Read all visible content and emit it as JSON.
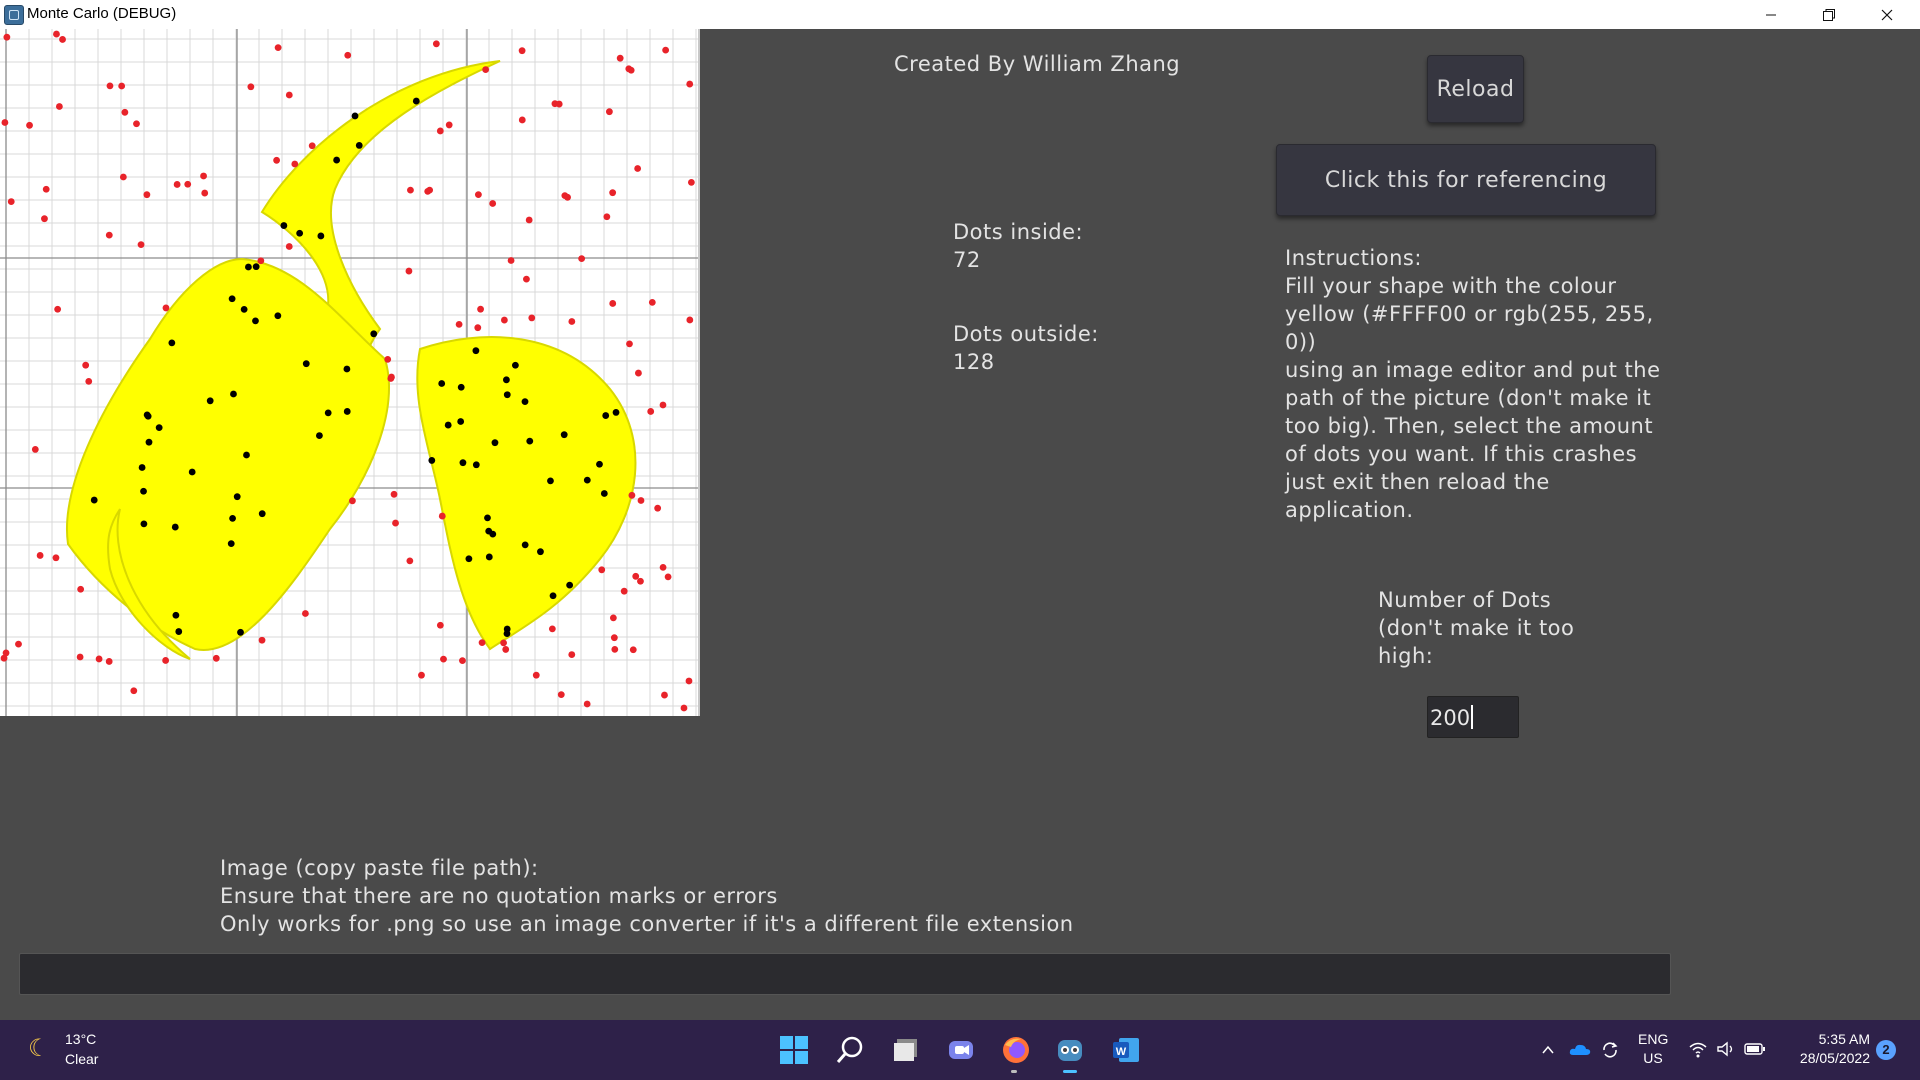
{
  "window": {
    "title": "Monte Carlo (DEBUG)",
    "icon": "app-window-icon",
    "controls": [
      "minimize-icon",
      "maximize-icon",
      "close-icon"
    ]
  },
  "canvas": {
    "background": "#ffffff",
    "grid_color": "#d9d9d9",
    "shape_color": "#FFFF00",
    "inside_dot_color": "#000000",
    "outside_dot_color": "#e8232a"
  },
  "credit": "Created By William Zhang",
  "reload_button": "Reload",
  "reference_button": "Click this for referencing",
  "stats": {
    "inside_label": "Dots inside:",
    "inside_value": "72",
    "outside_label": "Dots outside:",
    "outside_value": "128"
  },
  "instructions": "Instructions:\nFill your shape with the colour\nyellow (#FFFF00 or rgb(255, 255, 0))\nusing an image editor and put the\npath of the picture (don't make it\ntoo big). Then, select the amount\nof dots you want. If this crashes\njust exit then reload the\napplication.",
  "dots": {
    "label": "Number of Dots\n(don't make it too\nhigh:",
    "value": "200"
  },
  "image_path": {
    "help": "Image (copy paste file path):\nEnsure that there are no quotation marks or errors\nOnly works for .png so use an image converter if it's a different file extension",
    "value": ""
  },
  "taskbar": {
    "weather_temp": "13°C",
    "weather_cond": "Clear",
    "apps": [
      "start-icon",
      "search-icon",
      "file-explorer-icon",
      "teams-chat-icon",
      "firefox-icon",
      "godot-icon",
      "word-icon"
    ],
    "lang_line1": "ENG",
    "lang_line2": "US",
    "time": "5:35 AM",
    "date": "28/05/2022",
    "notifications": "2"
  }
}
